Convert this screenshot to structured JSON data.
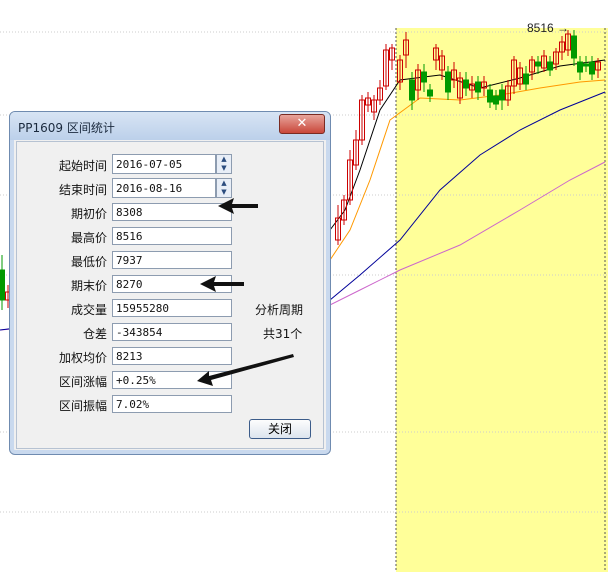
{
  "chart": {
    "peak_label": "8516",
    "colors": {
      "highlight": "#ffff99",
      "up_candle": "#cc0000",
      "down_candle": "#009900",
      "ma_short": "#000000",
      "ma_mid": "#ff9900",
      "ma_long": "#000099",
      "ma_longer": "#cc66cc"
    }
  },
  "dialog": {
    "title": "PP1609 区间统计",
    "close_icon": "close-icon",
    "rows": [
      {
        "label": "起始时间",
        "value": "2016-07-05"
      },
      {
        "label": "结束时间",
        "value": "2016-08-16"
      },
      {
        "label": "期初价",
        "value": "8308"
      },
      {
        "label": "最高价",
        "value": "8516"
      },
      {
        "label": "最低价",
        "value": "7937"
      },
      {
        "label": "期末价",
        "value": "8270"
      },
      {
        "label": "成交量",
        "value": "15955280"
      },
      {
        "label": "仓差",
        "value": "-343854"
      },
      {
        "label": "加权均价",
        "value": "8213"
      },
      {
        "label": "区间涨幅",
        "value": "+0.25%"
      },
      {
        "label": "区间振幅",
        "value": "7.02%"
      }
    ],
    "period_title": "分析周期",
    "period_count": "共31个",
    "close_button": "关闭"
  }
}
